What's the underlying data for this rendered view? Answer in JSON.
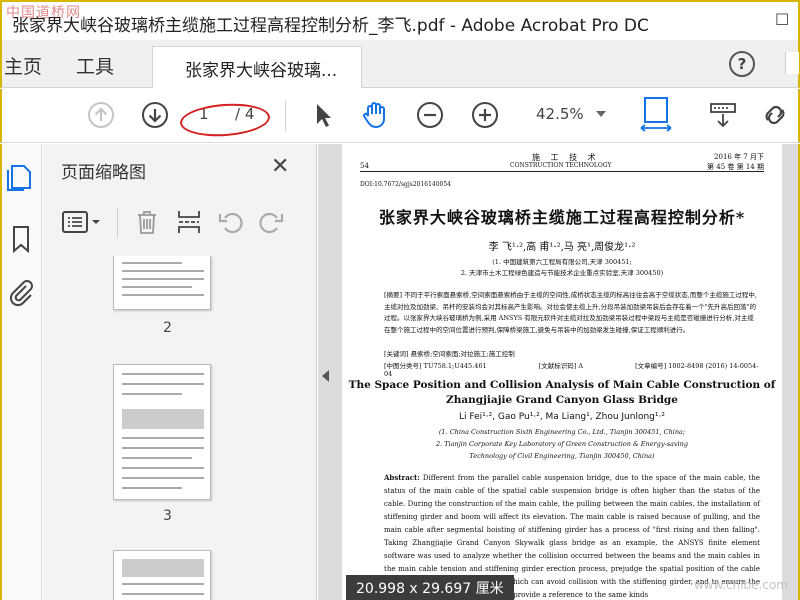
{
  "window": {
    "title": "张家界大峡谷玻璃桥主缆施工过程高程控制分析_李飞.pdf - Adobe Acrobat Pro DC",
    "watermark": "中国道桥网",
    "watermark_bottom": "www.cnlbe.com"
  },
  "tabs": {
    "home": "主页",
    "tools": "工具",
    "document": "张家界大峡谷玻璃...",
    "help": "?"
  },
  "toolbar": {
    "page_current": "1",
    "page_total": "/ 4",
    "zoom": "42.5%"
  },
  "thumbnail_panel": {
    "title": "页面缩略图",
    "pages": [
      "2",
      "3"
    ]
  },
  "document": {
    "header_left": "54",
    "header_center": "施 工 技 术",
    "header_center_en": "CONSTRUCTION TECHNOLOGY",
    "header_right1": "2016 年 7 月下",
    "header_right2": "第 45 卷  第 14 期",
    "doi": "DOI:10.7672/sgjs2016140054",
    "title_cn": "张家界大峡谷玻璃桥主缆施工过程高程控制分析*",
    "authors_cn": "李  飞¹·²,高  甫¹·²,马  亮¹,周俊龙¹·²",
    "aff_cn1": "(1. 中国建筑第六工程局有限公司,天津  300451;",
    "aff_cn2": "2. 天津市土木工程绿色建造与节能技术企业重点实验室,天津  300450)",
    "abstract_cn": "[摘要] 不同于平行索面悬索桥,空间索面悬索桥由于主缆的空间性,成桥状态主缆的标高往往会高于空缆状态,而整个主缆施工过程中,主缆对拉及加劲梁、吊杆的安装均会对其标高产生影响。对拉会使主缆上升,分段吊装加劲梁吊装后会存在着一个\"先升高后回落\"的过程。以张家界大峡谷玻璃桥为例,采用 ANSYS 有限元软件对主缆对拉及加劲梁吊装过程中梁段与主缆是否碰撞进行分析,对主缆在整个施工过程中的空间位置进行预判,保障桥梁施工,避免与吊装中的加劲梁发生碰撞,保证工程顺利进行。",
    "keywords_cn": "[关键词] 悬索桥;空间索面;对拉施工;施工控制",
    "class_no": "[中图分类号] TU758.1;U445.461",
    "doc_code": "[文献标识码] A",
    "article_no": "[文章编号] 1002-8498 (2016) 14-0054-04",
    "title_en": "The Space Position and Collision Analysis of Main Cable Construction of Zhangjiajie Grand Canyon Glass Bridge",
    "authors_en": "Li Fei¹·², Gao Pu¹·², Ma Liang¹, Zhou Junlong¹·²",
    "aff_en1": "(1. China Construction Sixth Engineering Co., Ltd., Tianjin  300451, China;",
    "aff_en2": "2. Tianjin Corporate Key Laboratory of Green Construction & Energy-saving",
    "aff_en3": "Technology of Civil Engineering, Tianjin  300450, China)",
    "abstract_en_label": "Abstract:",
    "abstract_en": "Different from the parallel cable suspension bridge, due to the space of the main cable, the status of the main cable of the spatial cable suspension bridge is often higher than the status of the cable. During the construction of the main cable, the pulling between the main cables, the installation of stiffening girder and boom will affect its elevation. The main cable is raised because of pulling, and the main cable after segmental hoisting of stiffening girder has a process of \"first rising and then falling\". Taking Zhangjiajie Grand Canyon Skywalk glass bridge as an example, the ANSYS finite element software was used to analyze whether the collision occurred between the beams and the main cables in the main cable tension and stiffening girder erection process, prejudge the spatial position of the cable in the construction of the bridge, which can avoid collision with the stiffening girder, and to ensure the smooth progress of the project, and provide a reference to the same kinds"
  },
  "status": {
    "page_size": "20.998 x 29.697 厘米"
  }
}
